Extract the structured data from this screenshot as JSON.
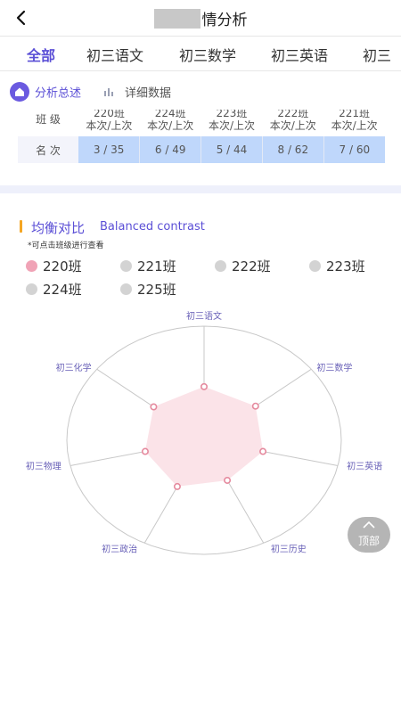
{
  "header": {
    "title": "情分析"
  },
  "tabs": [
    {
      "label": "全部",
      "active": true
    },
    {
      "label": "初三语文",
      "active": false
    },
    {
      "label": "初三数学",
      "active": false
    },
    {
      "label": "初三英语",
      "active": false
    },
    {
      "label": "初三",
      "active": false
    }
  ],
  "subtabs": [
    {
      "label": "分析总述",
      "icon": "home-icon",
      "active": true
    },
    {
      "label": "详细数据",
      "icon": "bar-chart-icon",
      "active": false
    }
  ],
  "rank_table": {
    "header_label": "班 级",
    "class_headers": [
      "220班",
      "224班",
      "223班",
      "222班",
      "221班"
    ],
    "subheader": "本次/上次",
    "row_label": "名 次",
    "values": [
      "3 / 35",
      "6 / 49",
      "5 / 44",
      "8 / 62",
      "7 / 60"
    ]
  },
  "section": {
    "title_cn": "均衡对比",
    "title_en": "Balanced contrast",
    "hint": "*可点击班级进行查看"
  },
  "legend": [
    {
      "label": "220班",
      "color": "#f0a3b6",
      "selected": true
    },
    {
      "label": "221班",
      "color": "#d3d3d3",
      "selected": false
    },
    {
      "label": "222班",
      "color": "#d3d3d3",
      "selected": false
    },
    {
      "label": "223班",
      "color": "#d3d3d3",
      "selected": false
    },
    {
      "label": "224班",
      "color": "#d3d3d3",
      "selected": false
    },
    {
      "label": "225班",
      "color": "#d3d3d3",
      "selected": false
    }
  ],
  "chart_data": {
    "type": "radar",
    "axes": [
      "初三语文",
      "初三数学",
      "初三英语",
      "初三历史",
      "初三政治",
      "初三物理",
      "初三化学"
    ],
    "series": [
      {
        "name": "220班",
        "values": [
          0.47,
          0.48,
          0.44,
          0.39,
          0.45,
          0.44,
          0.47
        ],
        "color": "#e58a9e",
        "fill": "#fbe3e8"
      }
    ],
    "range": [
      0,
      1
    ],
    "grid": "single outer circle",
    "colors": {
      "axis": "#c8c8c8",
      "label": "#6a62b8"
    }
  },
  "top_button": {
    "label": "顶部"
  },
  "colors": {
    "accent": "#5b4fd6",
    "table_highlight": "#bfd7fb",
    "section_bar": "#f5a623"
  }
}
